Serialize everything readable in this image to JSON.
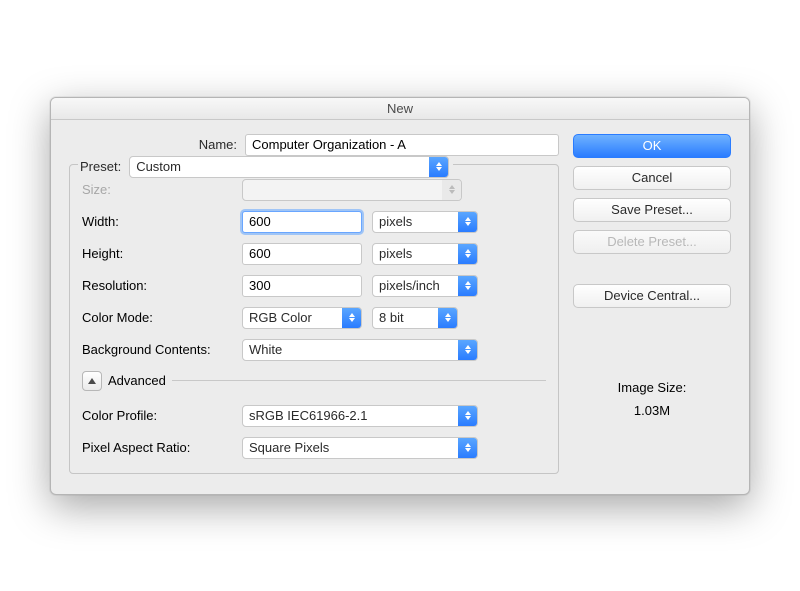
{
  "title": "New",
  "name": {
    "label": "Name:",
    "value": "Computer Organization - A"
  },
  "preset": {
    "label": "Preset:",
    "value": "Custom"
  },
  "size": {
    "label": "Size:",
    "value": ""
  },
  "width": {
    "label": "Width:",
    "value": "600",
    "unit": "pixels"
  },
  "height": {
    "label": "Height:",
    "value": "600",
    "unit": "pixels"
  },
  "resolution": {
    "label": "Resolution:",
    "value": "300",
    "unit": "pixels/inch"
  },
  "color_mode": {
    "label": "Color Mode:",
    "value": "RGB Color",
    "depth": "8 bit"
  },
  "background": {
    "label": "Background Contents:",
    "value": "White"
  },
  "advanced": {
    "label": "Advanced"
  },
  "color_profile": {
    "label": "Color Profile:",
    "value": "sRGB IEC61966-2.1"
  },
  "pixel_aspect": {
    "label": "Pixel Aspect Ratio:",
    "value": "Square Pixels"
  },
  "buttons": {
    "ok": "OK",
    "cancel": "Cancel",
    "save_preset": "Save Preset...",
    "delete_preset": "Delete Preset...",
    "device_central": "Device Central..."
  },
  "image_size": {
    "label": "Image Size:",
    "value": "1.03M"
  }
}
